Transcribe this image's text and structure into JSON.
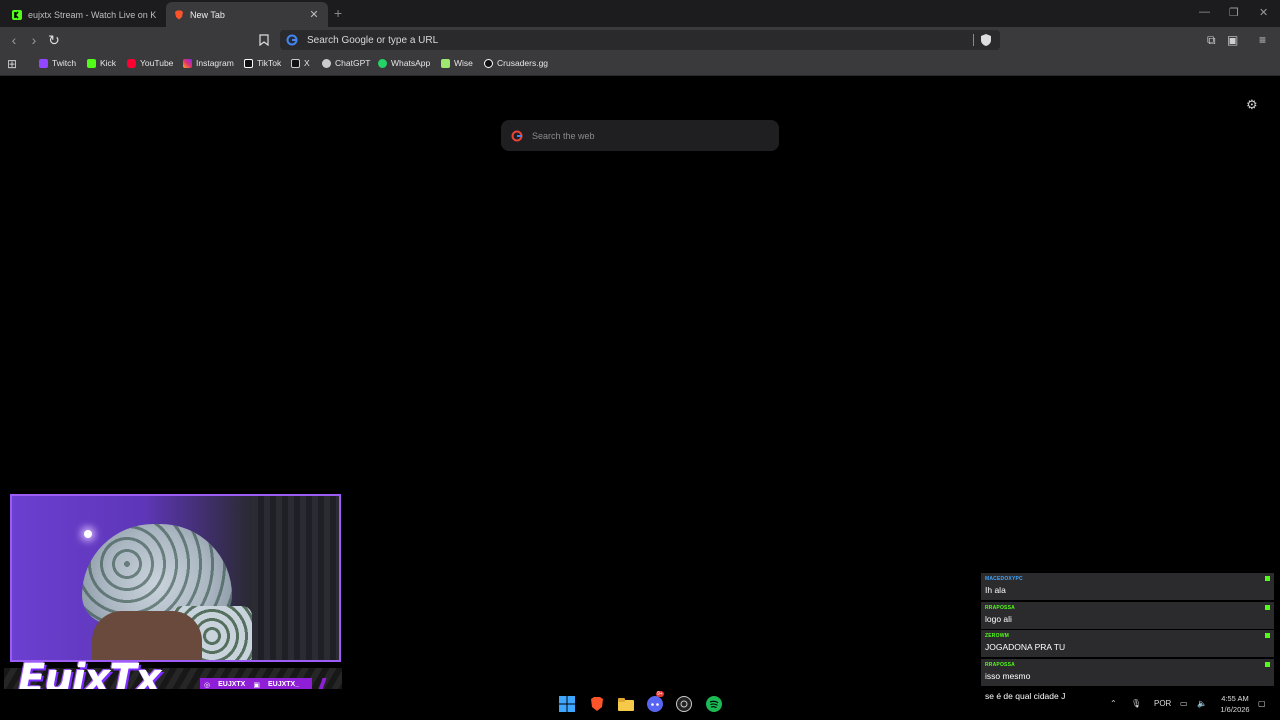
{
  "tabs": [
    {
      "title": "eujxtx Stream - Watch Live on Kick",
      "favicon": "kick-icon",
      "active": false
    },
    {
      "title": "New Tab",
      "favicon": "brave-icon",
      "active": true
    }
  ],
  "omnibox": {
    "placeholder": "Search Google or type a URL"
  },
  "bookmarks": [
    {
      "label": "Twitch",
      "icon": "twitch-icon",
      "color": "#9146ff"
    },
    {
      "label": "Kick",
      "icon": "kick-icon",
      "color": "#53fc18"
    },
    {
      "label": "YouTube",
      "icon": "youtube-icon",
      "color": "#ff0033"
    },
    {
      "label": "Instagram",
      "icon": "instagram-icon",
      "color": "#e1306c"
    },
    {
      "label": "TikTok",
      "icon": "tiktok-icon",
      "color": "#ffffff"
    },
    {
      "label": "X",
      "icon": "x-icon",
      "color": "#ffffff"
    },
    {
      "label": "ChatGPT",
      "icon": "chatgpt-icon",
      "color": "#cccccc"
    },
    {
      "label": "WhatsApp",
      "icon": "whatsapp-icon",
      "color": "#25d366"
    },
    {
      "label": "Wise",
      "icon": "wise-icon",
      "color": "#9fe870"
    },
    {
      "label": "Crusaders.gg",
      "icon": "crusaders-icon",
      "color": "#ffffff"
    }
  ],
  "newtab": {
    "search_placeholder": "Search the web"
  },
  "overlay": {
    "logo_text": "EujxTx",
    "instagram_handle": "EUJXTX",
    "twitch_handle": "EUJXTX_"
  },
  "chat": [
    {
      "user": "MACEDOXYPC",
      "text": "Ih ala",
      "user_color": "#3ea6ff"
    },
    {
      "user": "RRAPOSSA",
      "text": "logo ali",
      "user_color": "#53fc18"
    },
    {
      "user": "ZEROWM",
      "text": "JOGADONA PRA TU",
      "user_color": "#53fc18"
    },
    {
      "user": "RRAPOSSA",
      "text": "isso mesmo",
      "user_color": "#53fc18"
    },
    {
      "user": "",
      "text": "se é de qual cidade J",
      "user_color": "#ff4d4d"
    }
  ],
  "taskbar": {
    "language": "POR",
    "time": "4:55 AM",
    "date": "1/6/2026",
    "discord_badge": "9+"
  }
}
